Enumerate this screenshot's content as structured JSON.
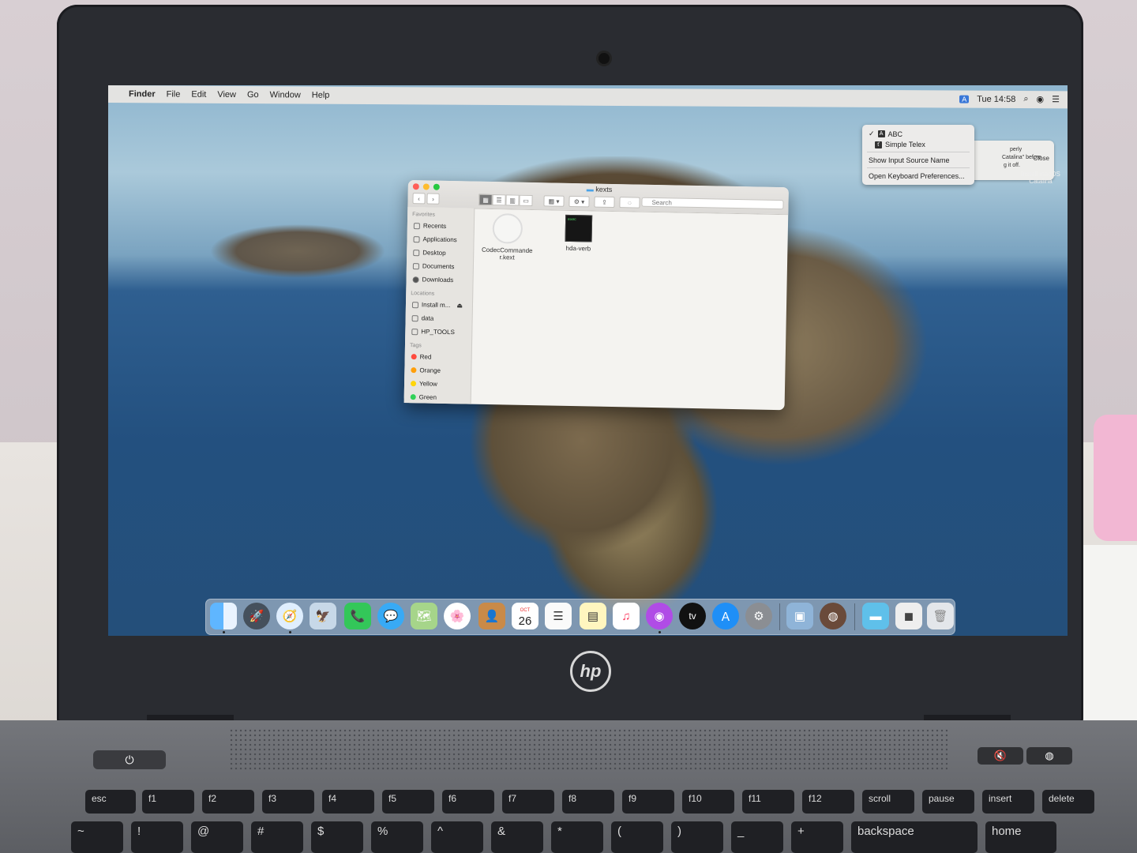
{
  "menubar": {
    "apple_glyph": "",
    "items": [
      "Finder",
      "File",
      "Edit",
      "View",
      "Go",
      "Window",
      "Help"
    ],
    "input_badge": "A",
    "clock": "Tue 14:58",
    "search_glyph": "⌕",
    "siri_glyph": "◉",
    "control_glyph": "☰"
  },
  "input_menu": {
    "check": "✓",
    "abc_icon": "A",
    "abc_label": "ABC",
    "telex_icon": "ť",
    "telex_label": "Simple Telex",
    "show_source_name": "Show Input Source Name",
    "open_prefs": "Open Keyboard Preferences..."
  },
  "notification": {
    "line1": "perly",
    "line2": "Catalina\" before",
    "line3": "g it off.",
    "close": "Close"
  },
  "desktop_item": {
    "line1": "Install macOS",
    "line2": "Catalina"
  },
  "finder": {
    "title": "kexts",
    "back": "‹",
    "forward": "›",
    "search_placeholder": "Search",
    "view_icon_grid": "▦",
    "view_list": "☰",
    "view_columns": "▥",
    "view_gallery": "▭",
    "group_glyph": "▦ ▾",
    "action_glyph": "⚙ ▾",
    "share_glyph": "⇪",
    "tag_glyph": "◌",
    "sidebar": {
      "favorites_header": "Favorites",
      "favorites": [
        "Recents",
        "Applications",
        "Desktop",
        "Documents",
        "Downloads"
      ],
      "locations_header": "Locations",
      "locations": [
        "Install m...",
        "data",
        "HP_TOOLS"
      ],
      "eject": "⏏",
      "tags_header": "Tags",
      "tags": [
        {
          "name": "Red",
          "color": "#ff4b3e"
        },
        {
          "name": "Orange",
          "color": "#ff9f0a"
        },
        {
          "name": "Yellow",
          "color": "#ffd60a"
        },
        {
          "name": "Green",
          "color": "#30d158"
        }
      ]
    },
    "files": [
      {
        "line1": "CodecCommande",
        "line2": "r.kext",
        "icon": "kext-icon"
      },
      {
        "line1": "hda-verb",
        "line2": "",
        "icon": "exec-icon",
        "icon_text": "exec"
      }
    ]
  },
  "dock": {
    "calendar_month": "OCT",
    "calendar_day": "26",
    "tv_label": "tv"
  },
  "laptop": {
    "brand": "hp",
    "power_glyph": "⏻",
    "mute_glyph": "🔇",
    "wifi_glyph": "◍",
    "fn_keys": [
      "esc",
      "f1",
      "f2",
      "f3",
      "f4",
      "f5",
      "f6",
      "f7",
      "f8",
      "f9",
      "f10",
      "f11",
      "f12",
      "scroll",
      "pause",
      "insert",
      "delete"
    ],
    "row2_keys": [
      "~",
      "!",
      "@",
      "#",
      "$",
      "%",
      "^",
      "&",
      "*",
      "(",
      ")",
      "_",
      "+",
      "backspace",
      "home"
    ]
  },
  "colors": {
    "close": "#ff5f57",
    "minimize": "#febc2e",
    "zoom": "#28c840"
  }
}
